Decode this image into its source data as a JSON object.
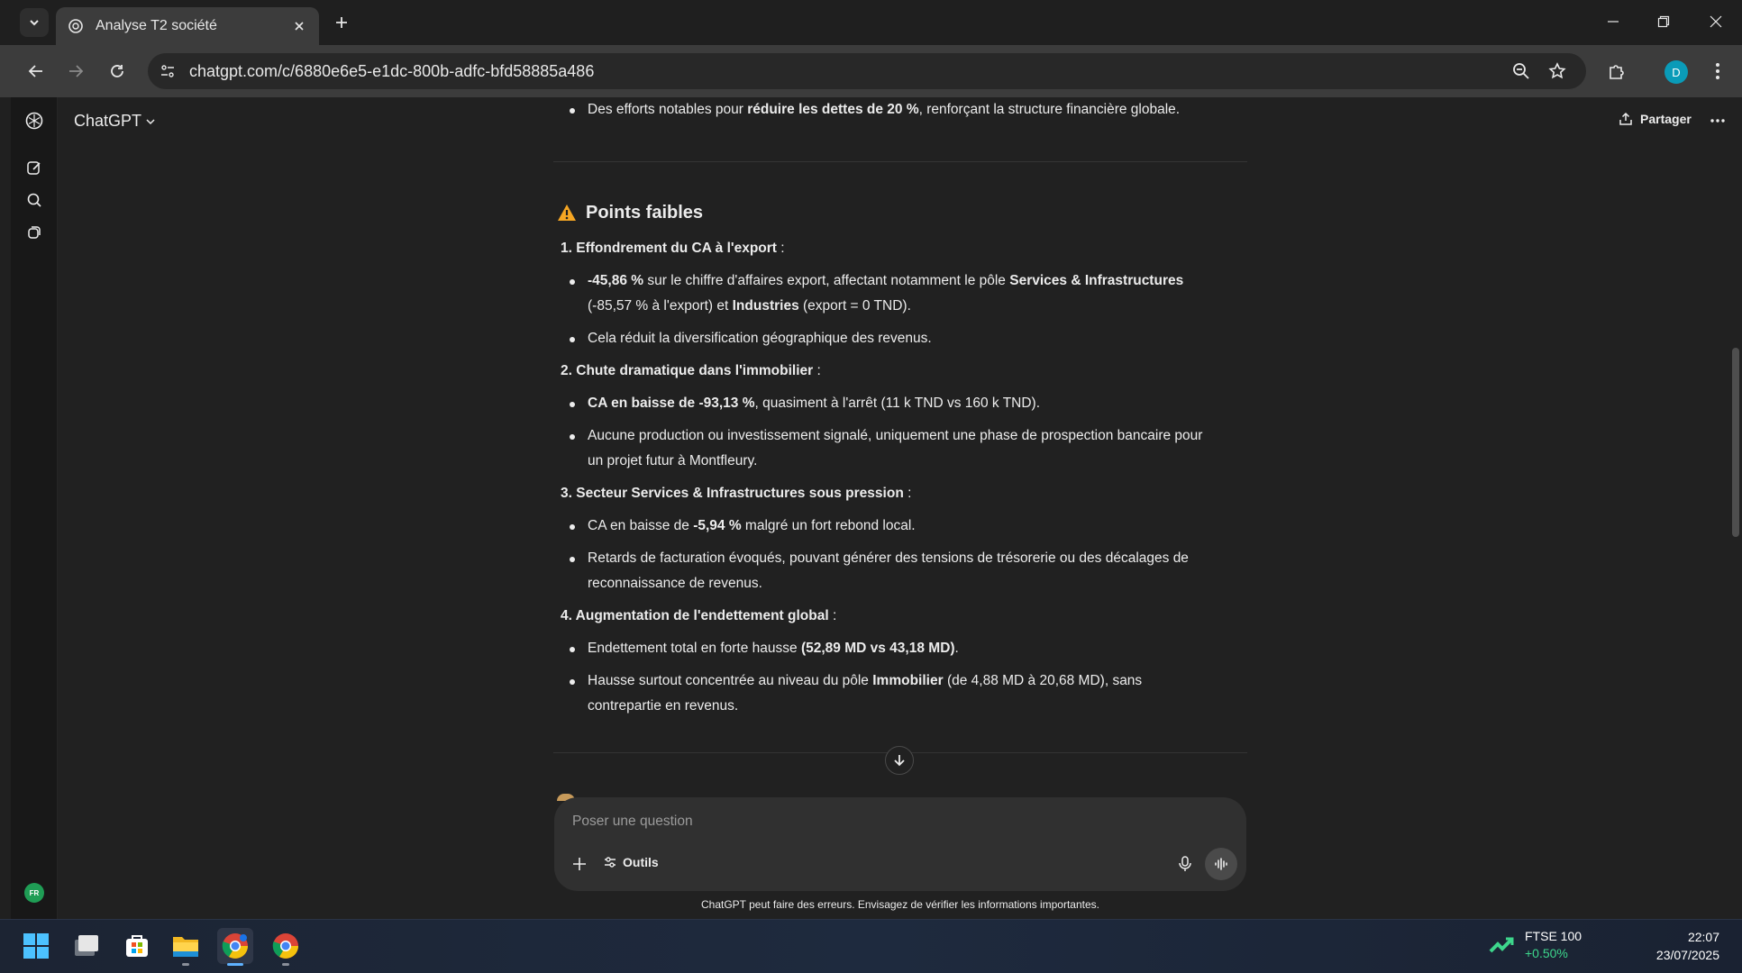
{
  "browser": {
    "tab_title": "Analyse T2 société",
    "url": "chatgpt.com/c/6880e6e5-e1dc-800b-adfc-bfd58885a486",
    "profile_initial": "D"
  },
  "app": {
    "brand": "ChatGPT",
    "share_label": "Partager",
    "lang_badge": "FR"
  },
  "article": {
    "top_bullet": {
      "pre": "Des efforts notables pour ",
      "bold": "réduire les dettes de 20 %",
      "post": ", renforçant la structure financière globale."
    },
    "section_title": "Points faibles",
    "items": [
      {
        "num": "1.",
        "title": "Effondrement du CA à l'export",
        "colon": " :",
        "b1": {
          "bold1": "-45,86 %",
          "t1": " sur le chiffre d'affaires export, affectant notamment le pôle ",
          "bold2": "Services & Infrastructures",
          "line2_t1": "(-85,57 % à l'export) et ",
          "line2_bold": "Industries",
          "line2_t2": " (export = 0 TND)."
        },
        "b2": "Cela réduit la diversification géographique des revenus."
      },
      {
        "num": "2.",
        "title": "Chute dramatique dans l'immobilier",
        "colon": " :",
        "b1": {
          "bold": "CA en baisse de -93,13 %",
          "t": ", quasiment à l'arrêt (11 k TND vs 160 k TND)."
        },
        "b2": {
          "line1": "Aucune production ou investissement signalé, uniquement une phase de prospection bancaire pour",
          "line2": "un projet futur à Montfleury."
        }
      },
      {
        "num": "3.",
        "title": "Secteur Services & Infrastructures sous pression",
        "colon": " :",
        "b1": {
          "t1": "CA en baisse de ",
          "bold": "-5,94 %",
          "t2": " malgré un fort rebond local."
        },
        "b2": {
          "line1": "Retards de facturation évoqués, pouvant générer des tensions de trésorerie ou des décalages de",
          "line2": "reconnaissance de revenus."
        }
      },
      {
        "num": "4.",
        "title": "Augmentation de l'endettement global",
        "colon": " :",
        "b1": {
          "t1": "Endettement total en forte hausse ",
          "bold": "(52,89 MD vs 43,18 MD)",
          "t2": "."
        },
        "b2": {
          "t1": "Hausse surtout concentrée au niveau du pôle ",
          "bold": "Immobilier",
          "t2": " (de 4,88 MD à 20,68 MD), sans",
          "line2": "contrepartie en revenus."
        }
      }
    ]
  },
  "composer": {
    "placeholder": "Poser une question",
    "tools_label": "Outils"
  },
  "disclaimer": "ChatGPT peut faire des erreurs. Envisagez de vérifier les informations importantes.",
  "taskbar": {
    "stock_name": "FTSE 100",
    "stock_change": "+0.50%",
    "time": "22:07",
    "date": "23/07/2025"
  },
  "colors": {
    "accent_profile": "#0a9bb8",
    "warning": "#f5a623",
    "stock_up": "#3dd68c"
  }
}
